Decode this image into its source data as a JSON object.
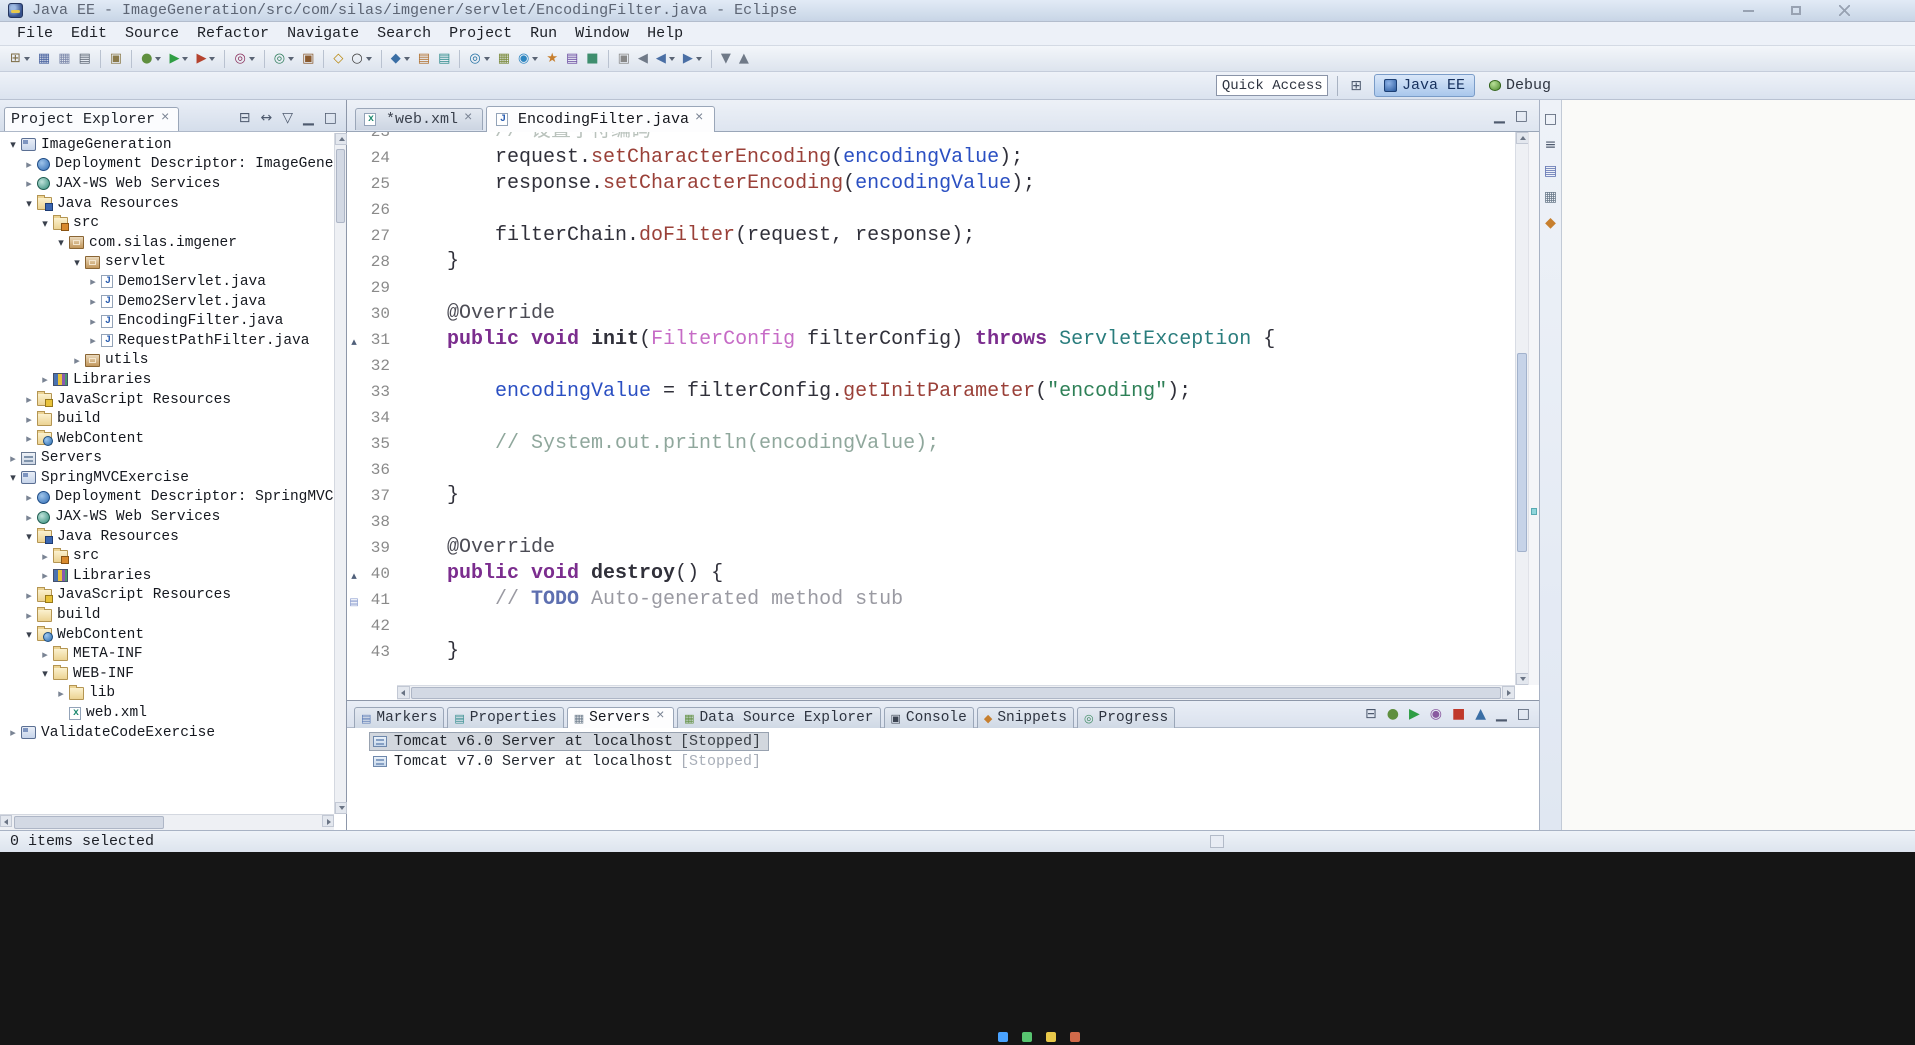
{
  "window": {
    "title": "Java EE - ImageGeneration/src/com/silas/imgener/servlet/EncodingFilter.java - Eclipse"
  },
  "menubar": {
    "items": [
      "File",
      "Edit",
      "Source",
      "Refactor",
      "Navigate",
      "Search",
      "Project",
      "Run",
      "Window",
      "Help"
    ]
  },
  "toolbar": {
    "buttons": [
      {
        "name": "new-wizard",
        "glyph": "⊞",
        "color": "#7a6840",
        "dropdown": true
      },
      {
        "name": "save",
        "glyph": "▦",
        "color": "#46609e"
      },
      {
        "name": "save-all",
        "glyph": "▦",
        "color": "#7a86a8"
      },
      {
        "name": "print",
        "glyph": "▤",
        "color": "#5a6472"
      },
      {
        "separator": true
      },
      {
        "name": "build-all",
        "glyph": "▣",
        "color": "#8a7a4a"
      },
      {
        "separator": true
      },
      {
        "name": "debug",
        "glyph": "●",
        "color": "#5f8f3e",
        "dropdown": true
      },
      {
        "name": "run",
        "glyph": "▶",
        "color": "#2f9e44",
        "dropdown": true
      },
      {
        "name": "external-tools",
        "glyph": "▶",
        "color": "#b5432e",
        "dropdown": true
      },
      {
        "separator": true
      },
      {
        "name": "coverage",
        "glyph": "◎",
        "color": "#8a2e5a",
        "dropdown": true
      },
      {
        "separator": true
      },
      {
        "name": "new-java-class",
        "glyph": "◎",
        "color": "#2e7d5b",
        "dropdown": true
      },
      {
        "name": "new-java-package",
        "glyph": "▣",
        "color": "#8a5a2e"
      },
      {
        "separator": true
      },
      {
        "name": "open-type",
        "glyph": "◇",
        "color": "#b8860b"
      },
      {
        "name": "search",
        "glyph": "○",
        "color": "#3c3c3c",
        "dropdown": true
      },
      {
        "separator": true
      },
      {
        "name": "new-servlet",
        "glyph": "◆",
        "color": "#3a6ea5",
        "dropdown": true
      },
      {
        "name": "new-jsp",
        "glyph": "▤",
        "color": "#b07030"
      },
      {
        "name": "new-xml",
        "glyph": "▤",
        "color": "#2e8b8b"
      },
      {
        "separator": true
      },
      {
        "name": "web-service",
        "glyph": "◎",
        "color": "#2471a3",
        "dropdown": true
      },
      {
        "name": "database",
        "glyph": "▦",
        "color": "#7a8a3a"
      },
      {
        "name": "web-browser",
        "glyph": "◉",
        "color": "#2e86c1",
        "dropdown": true
      },
      {
        "name": "ant",
        "glyph": "★",
        "color": "#c77f2e"
      },
      {
        "name": "javadoc",
        "glyph": "▤",
        "color": "#6a4aa0"
      },
      {
        "name": "junit",
        "glyph": "■",
        "color": "#3e8e6e"
      },
      {
        "separator": true
      },
      {
        "name": "mark-occurrences",
        "glyph": "▣",
        "color": "#888888"
      },
      {
        "name": "last-edit-location",
        "glyph": "◀",
        "color": "#707a88"
      },
      {
        "name": "back",
        "glyph": "◀",
        "color": "#4a6fa5",
        "dropdown": true
      },
      {
        "name": "forward",
        "glyph": "▶",
        "color": "#4a6fa5",
        "dropdown": true
      },
      {
        "separator": true
      },
      {
        "name": "next-annotation",
        "glyph": "▼",
        "color": "#707a88"
      },
      {
        "name": "previous-annotation",
        "glyph": "▲",
        "color": "#707a88"
      }
    ]
  },
  "quick_access": {
    "label": "Quick Access"
  },
  "perspective_bar": {
    "open_perspective_glyph": "⊞",
    "perspectives": [
      {
        "label": "Java EE",
        "icon": "java-ee-perspective-icon",
        "active": true
      },
      {
        "label": "Debug",
        "icon": "debug-perspective-icon",
        "active": false
      }
    ]
  },
  "project_explorer": {
    "title": "Project Explorer",
    "toolbar": [
      {
        "name": "collapse-all-icon",
        "glyph": "⊟",
        "color": "#4e5a6e"
      },
      {
        "name": "link-with-editor-icon",
        "glyph": "↔",
        "color": "#4e5a6e"
      },
      {
        "name": "view-menu-icon",
        "glyph": "▽",
        "color": "#4e5a6e"
      },
      {
        "name": "minimize-view-icon",
        "glyph": "▁",
        "color": "#4e5a6e"
      },
      {
        "name": "maximize-view-icon",
        "glyph": "□",
        "color": "#4e5a6e"
      }
    ],
    "items": [
      {
        "label": "ImageGeneration",
        "depth": 0,
        "state": "expanded",
        "icon": "project"
      },
      {
        "label": "Deployment Descriptor: ImageGene",
        "depth": 1,
        "state": "collapsed",
        "icon": "deployment-descriptor"
      },
      {
        "label": "JAX-WS Web Services",
        "depth": 1,
        "state": "collapsed",
        "icon": "jaxws"
      },
      {
        "label": "Java Resources",
        "depth": 1,
        "state": "expanded",
        "icon": "java-resources"
      },
      {
        "label": "src",
        "depth": 2,
        "state": "expanded",
        "icon": "source-folder"
      },
      {
        "label": "com.silas.imgener",
        "depth": 3,
        "state": "expanded",
        "icon": "package"
      },
      {
        "label": "servlet",
        "depth": 4,
        "state": "expanded",
        "icon": "package"
      },
      {
        "label": "Demo1Servlet.java",
        "depth": 5,
        "state": "collapsed",
        "icon": "java-file"
      },
      {
        "label": "Demo2Servlet.java",
        "depth": 5,
        "state": "collapsed",
        "icon": "java-file"
      },
      {
        "label": "EncodingFilter.java",
        "depth": 5,
        "state": "collapsed",
        "icon": "java-file"
      },
      {
        "label": "RequestPathFilter.java",
        "depth": 5,
        "state": "collapsed",
        "icon": "java-file"
      },
      {
        "label": "utils",
        "depth": 4,
        "state": "collapsed",
        "icon": "package"
      },
      {
        "label": "Libraries",
        "depth": 2,
        "state": "collapsed",
        "icon": "libraries"
      },
      {
        "label": "JavaScript Resources",
        "depth": 1,
        "state": "collapsed",
        "icon": "js-resources"
      },
      {
        "label": "build",
        "depth": 1,
        "state": "collapsed",
        "icon": "folder"
      },
      {
        "label": "WebContent",
        "depth": 1,
        "state": "collapsed",
        "icon": "web-folder"
      },
      {
        "label": "Servers",
        "depth": 0,
        "state": "collapsed",
        "icon": "servers-project"
      },
      {
        "label": "SpringMVCExercise",
        "depth": 0,
        "state": "expanded",
        "icon": "project"
      },
      {
        "label": "Deployment Descriptor: SpringMVC",
        "depth": 1,
        "state": "collapsed",
        "icon": "deployment-descriptor"
      },
      {
        "label": "JAX-WS Web Services",
        "depth": 1,
        "state": "collapsed",
        "icon": "jaxws"
      },
      {
        "label": "Java Resources",
        "depth": 1,
        "state": "expanded",
        "icon": "java-resources"
      },
      {
        "label": "src",
        "depth": 2,
        "state": "collapsed",
        "icon": "source-folder"
      },
      {
        "label": "Libraries",
        "depth": 2,
        "state": "collapsed",
        "icon": "libraries"
      },
      {
        "label": "JavaScript Resources",
        "depth": 1,
        "state": "collapsed",
        "icon": "js-resources"
      },
      {
        "label": "build",
        "depth": 1,
        "state": "collapsed",
        "icon": "folder"
      },
      {
        "label": "WebContent",
        "depth": 1,
        "state": "expanded",
        "icon": "web-folder"
      },
      {
        "label": "META-INF",
        "depth": 2,
        "state": "collapsed",
        "icon": "folder"
      },
      {
        "label": "WEB-INF",
        "depth": 2,
        "state": "expanded",
        "icon": "folder"
      },
      {
        "label": "lib",
        "depth": 3,
        "state": "collapsed",
        "icon": "folder"
      },
      {
        "label": "web.xml",
        "depth": 3,
        "state": "leaf",
        "icon": "xml-file"
      },
      {
        "label": "ValidateCodeExercise",
        "depth": 0,
        "state": "collapsed",
        "icon": "project"
      }
    ]
  },
  "editor": {
    "tabs": [
      {
        "label": "*web.xml",
        "icon": "xml-file",
        "active": false
      },
      {
        "label": "EncodingFilter.java",
        "icon": "java-file",
        "active": true
      }
    ],
    "toolbar": [
      {
        "name": "minimize-editor-icon",
        "glyph": "▁",
        "color": "#4e5a6e"
      },
      {
        "name": "maximize-editor-icon",
        "glyph": "□",
        "color": "#4e5a6e"
      }
    ],
    "overview_marker": {
      "top_pct": 68,
      "color": "#8fd6dc"
    },
    "lines": [
      {
        "n": 23,
        "segs": [
          {
            "t": "        // 设置字符编码",
            "c": "comment-dim"
          }
        ]
      },
      {
        "n": 24,
        "segs": [
          {
            "t": "        request.",
            "c": "plain"
          },
          {
            "t": "setCharacterEncoding",
            "c": "method"
          },
          {
            "t": "(",
            "c": "plain"
          },
          {
            "t": "encodingValue",
            "c": "field"
          },
          {
            "t": ");",
            "c": "plain"
          }
        ]
      },
      {
        "n": 25,
        "segs": [
          {
            "t": "        response.",
            "c": "plain"
          },
          {
            "t": "setCharacterEncoding",
            "c": "method"
          },
          {
            "t": "(",
            "c": "plain"
          },
          {
            "t": "encodingValue",
            "c": "field"
          },
          {
            "t": ");",
            "c": "plain"
          }
        ]
      },
      {
        "n": 26,
        "segs": []
      },
      {
        "n": 27,
        "segs": [
          {
            "t": "        filterChain.",
            "c": "plain"
          },
          {
            "t": "doFilter",
            "c": "method"
          },
          {
            "t": "(request, response);",
            "c": "plain"
          }
        ]
      },
      {
        "n": 28,
        "segs": [
          {
            "t": "    }",
            "c": "plain"
          }
        ]
      },
      {
        "n": 29,
        "segs": []
      },
      {
        "n": 30,
        "segs": [
          {
            "t": "    @Override",
            "c": "annotation"
          }
        ]
      },
      {
        "n": 31,
        "marker": "override",
        "segs": [
          {
            "t": "    ",
            "c": "plain"
          },
          {
            "t": "public void ",
            "c": "keyword"
          },
          {
            "t": "init",
            "c": "mdecl"
          },
          {
            "t": "(",
            "c": "plain"
          },
          {
            "t": "FilterConfig",
            "c": "type-pink"
          },
          {
            "t": " filterConfig) ",
            "c": "plain"
          },
          {
            "t": "throws",
            "c": "keyword"
          },
          {
            "t": " ",
            "c": "plain"
          },
          {
            "t": "ServletException",
            "c": "type-teal"
          },
          {
            "t": " {",
            "c": "plain"
          }
        ]
      },
      {
        "n": 32,
        "segs": []
      },
      {
        "n": 33,
        "segs": [
          {
            "t": "        ",
            "c": "plain"
          },
          {
            "t": "encodingValue",
            "c": "field"
          },
          {
            "t": " = filterConfig.",
            "c": "plain"
          },
          {
            "t": "getInitParameter",
            "c": "method"
          },
          {
            "t": "(",
            "c": "plain"
          },
          {
            "t": "\"encoding\"",
            "c": "string"
          },
          {
            "t": ");",
            "c": "plain"
          }
        ]
      },
      {
        "n": 34,
        "segs": []
      },
      {
        "n": 35,
        "segs": [
          {
            "t": "        // System.out.println(encodingValue);",
            "c": "comment"
          }
        ]
      },
      {
        "n": 36,
        "segs": []
      },
      {
        "n": 37,
        "segs": [
          {
            "t": "    }",
            "c": "plain"
          }
        ]
      },
      {
        "n": 38,
        "segs": []
      },
      {
        "n": 39,
        "segs": [
          {
            "t": "    @Override",
            "c": "annotation"
          }
        ]
      },
      {
        "n": 40,
        "marker": "override",
        "segs": [
          {
            "t": "    ",
            "c": "plain"
          },
          {
            "t": "public void ",
            "c": "keyword"
          },
          {
            "t": "destroy",
            "c": "mdecl"
          },
          {
            "t": "() {",
            "c": "plain"
          }
        ]
      },
      {
        "n": 41,
        "marker": "task",
        "segs": [
          {
            "t": "        ",
            "c": "plain"
          },
          {
            "t": "// ",
            "c": "comment2"
          },
          {
            "t": "TODO",
            "c": "todo"
          },
          {
            "t": " Auto-generated method stub",
            "c": "comment2"
          }
        ]
      },
      {
        "n": 42,
        "segs": []
      },
      {
        "n": 43,
        "segs": [
          {
            "t": "    }",
            "c": "plain"
          }
        ]
      }
    ]
  },
  "bottom_panel": {
    "tabs": [
      {
        "label": "Markers",
        "glyph": "▤",
        "color": "#5a7ab5",
        "active": false
      },
      {
        "label": "Properties",
        "glyph": "▤",
        "color": "#2e8b8b",
        "active": false
      },
      {
        "label": "Servers",
        "glyph": "▦",
        "color": "#6a7a8a",
        "active": true
      },
      {
        "label": "Data Source Explorer",
        "glyph": "▦",
        "color": "#5f8f3e",
        "active": false
      },
      {
        "label": "Console",
        "glyph": "▣",
        "color": "#3c4452",
        "active": false
      },
      {
        "label": "Snippets",
        "glyph": "◆",
        "color": "#c77f2e",
        "active": false
      },
      {
        "label": "Progress",
        "glyph": "◎",
        "color": "#3a8a5f",
        "active": false
      }
    ],
    "toolbar": [
      {
        "name": "collapse-all-icon",
        "glyph": "⊟",
        "color": "#4e5a6e"
      },
      {
        "name": "debug-server-icon",
        "glyph": "●",
        "color": "#5f8f3e"
      },
      {
        "name": "start-server-icon",
        "glyph": "▶",
        "color": "#2f9e44"
      },
      {
        "name": "profile-server-icon",
        "glyph": "◉",
        "color": "#8a5aa0"
      },
      {
        "name": "stop-server-icon",
        "glyph": "■",
        "color": "#c0392b"
      },
      {
        "name": "publish-icon",
        "glyph": "▲",
        "color": "#3a6ea5"
      },
      {
        "name": "minimize-view-icon",
        "glyph": "▁",
        "color": "#4e5a6e"
      },
      {
        "name": "maximize-view-icon",
        "glyph": "□",
        "color": "#4e5a6e"
      }
    ],
    "servers": [
      {
        "name": "Tomcat v6.0 Server at localhost",
        "status": "[Stopped]",
        "selected": true
      },
      {
        "name": "Tomcat v7.0 Server at localhost",
        "status": "[Stopped]",
        "selected": false
      }
    ]
  },
  "ministrip": {
    "icons": [
      {
        "name": "restore-views-icon",
        "glyph": "□",
        "color": "#4e5a6e"
      },
      {
        "name": "outline-view-icon",
        "glyph": "≡",
        "color": "#4e5a6e"
      },
      {
        "name": "task-list-view-icon",
        "glyph": "▤",
        "color": "#5a6eae"
      },
      {
        "name": "servers-view-icon",
        "glyph": "▦",
        "color": "#6a7a8a"
      },
      {
        "name": "snippets-view-icon",
        "glyph": "◆",
        "color": "#c77f2e"
      }
    ]
  },
  "statusbar": {
    "text": "0 items selected"
  },
  "desktop": {
    "taskbar_icon_colors": [
      "#4aa3ff",
      "#58c470",
      "#e8c84a",
      "#d06a4a"
    ]
  },
  "colors": {
    "perspective_active": "#b9d2f0",
    "selection_gray": "#d2d7de",
    "stopped_status_dim": "#a8aeb8",
    "overview_marker": "#8fd6dc"
  }
}
